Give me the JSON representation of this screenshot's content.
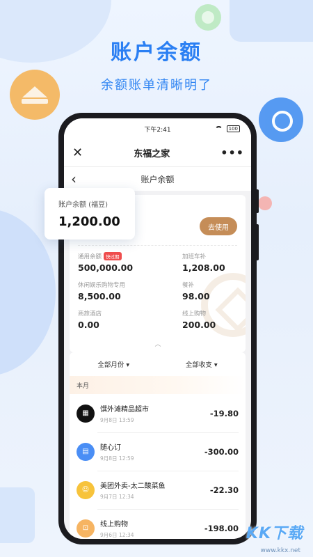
{
  "hero": {
    "title": "账户余额",
    "subtitle": "余额账单清晰明了"
  },
  "status_bar": {
    "time": "下午2:41",
    "battery": "100"
  },
  "app_bar": {
    "title": "东福之家",
    "close_icon": "close-icon",
    "more_icon": "more-icon",
    "more_glyph": "•••"
  },
  "nav_bar": {
    "title": "账户余额",
    "back_icon": "chevron-left-icon"
  },
  "balance_card": {
    "use_button": "去使用",
    "items": [
      {
        "label": "通用余额",
        "value": "500,000.00",
        "tag": "快过期"
      },
      {
        "label": "加班车补",
        "value": "1,208.00"
      },
      {
        "label": "休闲娱乐购物专用",
        "value": "8,500.00"
      },
      {
        "label": "餐补",
        "value": "98.00"
      },
      {
        "label": "商旅酒店",
        "value": "0.00"
      },
      {
        "label": "线上购物",
        "value": "200.00"
      }
    ]
  },
  "floating_card": {
    "label": "账户余额 (福豆)",
    "value": "1,200.00"
  },
  "filters": {
    "month": "全部月份 ▾",
    "type": "全部收支 ▾"
  },
  "month_header": "本月",
  "transactions": [
    {
      "name": "馔外滩精品超市",
      "time": "9月8日 13:59",
      "amount": "-19.80",
      "avatar_color": "#111111",
      "icon": "store-logo-icon"
    },
    {
      "name": "随心订",
      "time": "9月8日 12:59",
      "amount": "-300.00",
      "avatar_color": "#4a8ef5",
      "icon": "order-icon"
    },
    {
      "name": "美团外卖-太二酸菜鱼",
      "time": "9月7日 12:34",
      "amount": "-22.30",
      "avatar_color": "#f7c33b",
      "icon": "meituan-icon"
    },
    {
      "name": "线上购物",
      "time": "9月6日 12:34",
      "amount": "-198.00",
      "avatar_color": "#f6b462",
      "icon": "cart-icon"
    }
  ],
  "watermark": {
    "logo": "KK下载",
    "url": "www.kkx.net"
  },
  "colors": {
    "accent_blue": "#2a7ff3",
    "button_gold": "#c58d58",
    "tag_red": "#ef4d4d"
  }
}
